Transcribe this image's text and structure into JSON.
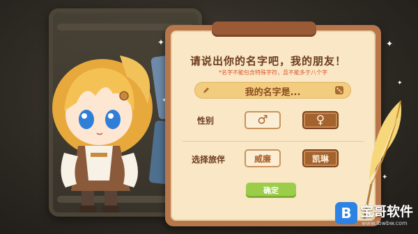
{
  "dialog": {
    "title": "请说出你的名字吧，我的朋友！",
    "hint": "*名字不能包含特殊字符，且不能多于八个字",
    "name_placeholder": "我的名字是...",
    "gender": {
      "label": "性别",
      "options": [
        "♂",
        "♀"
      ],
      "selected": "♀"
    },
    "companion": {
      "label": "选择旅伴",
      "options": [
        "威廉",
        "凯琳"
      ],
      "selected": "凯琳"
    },
    "confirm_label": "确定"
  },
  "watermark": {
    "logo_letter": "B",
    "text": "宝哥软件",
    "url": "www.lbwbw.com"
  },
  "colors": {
    "panel_frame": "#b8774a",
    "panel_paper": "#f9e7c5",
    "selected_button": "#a4622f",
    "confirm_green": "#9ccd4a",
    "hint_red": "#d9562c"
  }
}
